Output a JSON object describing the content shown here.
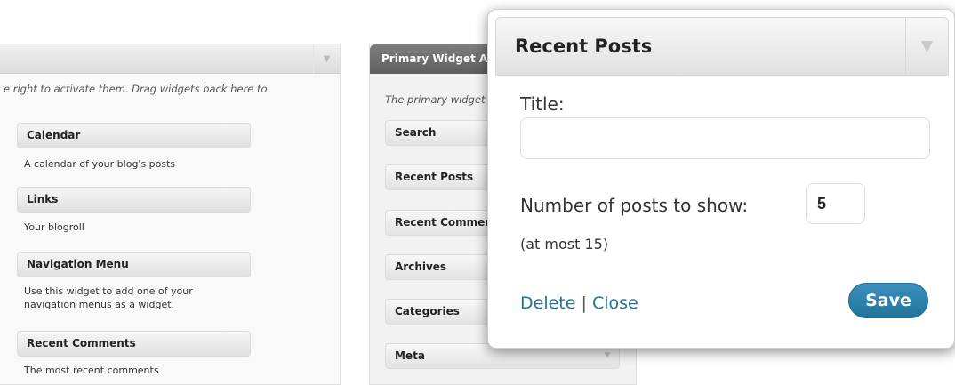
{
  "available": {
    "description": "e right to activate them. Drag widgets back here to",
    "widgets": [
      {
        "name": "Calendar",
        "description": "A calendar of your blog's posts"
      },
      {
        "name": "Links",
        "description": "Your blogroll"
      },
      {
        "name": "Navigation Menu",
        "description": "Use this widget to add one of your navigation menus as a widget."
      },
      {
        "name": "Recent Comments",
        "description": "The most recent comments"
      }
    ]
  },
  "primary": {
    "title": "Primary Widget A",
    "description": "The primary widget",
    "widgets": [
      "Search",
      "Recent Posts",
      "Recent Comment",
      "Archives",
      "Categories",
      "Meta"
    ]
  },
  "popup": {
    "title": "Recent Posts",
    "title_label": "Title:",
    "title_value": "",
    "number_label": "Number of posts to show:",
    "number_value": "5",
    "note": "(at most 15)",
    "delete_label": "Delete",
    "separator": "|",
    "close_label": "Close",
    "save_label": "Save"
  },
  "colors": {
    "link": "#21759b",
    "save_button": "#21759b",
    "primary_header": "#6e6e6e"
  }
}
